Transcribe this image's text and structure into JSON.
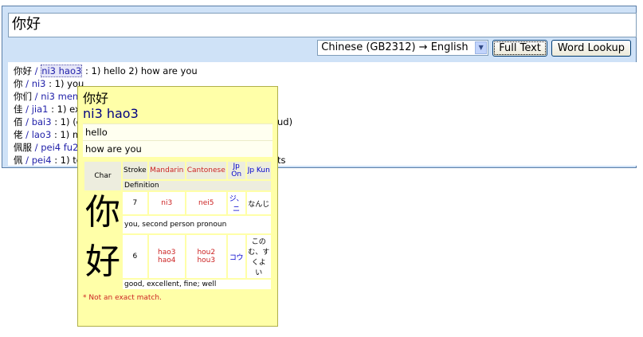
{
  "search": {
    "value": "你好"
  },
  "toolbar": {
    "direction": "Chinese (GB2312) → English",
    "full_text_label": "Full Text",
    "word_lookup_label": "Word Lookup"
  },
  "results": [
    {
      "word": "你好",
      "reading": "ni3 hao3",
      "defs": ": 1) hello 2) how are you"
    },
    {
      "word": "你",
      "reading": "ni3",
      "defs": ": 1) you"
    },
    {
      "word": "你们",
      "reading": "ni3 men5",
      "defs": ""
    },
    {
      "word": "佳",
      "reading": "jia1",
      "defs": ": 1) exc"
    },
    {
      "word": "佰",
      "reading": "bai3",
      "defs": ": 1) (co",
      "trail": "ud)"
    },
    {
      "word": "佬",
      "reading": "lao3",
      "defs": ": 1) ma"
    },
    {
      "word": "佩服",
      "reading": "pei4 fu2",
      "defs": ""
    },
    {
      "word": "佩",
      "reading": "pei4",
      "defs": ": 1) to",
      "trail": "ts"
    }
  ],
  "popup": {
    "word": "你好",
    "reading": "ni3 hao3",
    "definitions": [
      "hello",
      "how are you"
    ],
    "headers": {
      "char": "Char",
      "stroke": "Stroke",
      "mandarin": "Mandarin",
      "cantonese": "Cantonese",
      "jp_on": "Jp On",
      "jp_kun": "Jp Kun",
      "definition": "Definition"
    },
    "chars": [
      {
        "char": "你",
        "stroke": "7",
        "mandarin": "ni3",
        "cantonese": "nei5",
        "jp_on": "ジ、 ニ",
        "jp_kun": "なんじ",
        "definition": "you, second person pronoun"
      },
      {
        "char": "好",
        "stroke": "6",
        "mandarin": "hao3 hao4",
        "cantonese": "hou2 hou3",
        "jp_on": "コウ",
        "jp_kun": "この む、す くよ い",
        "definition": "good, excellent, fine; well"
      }
    ],
    "footnote": "* Not an exact match."
  },
  "colors": {
    "frame_bg": "#cfe2f7",
    "popup_bg": "#ffffa8",
    "reading_blue": "#2222aa",
    "mandarin_red": "#cc2222"
  }
}
